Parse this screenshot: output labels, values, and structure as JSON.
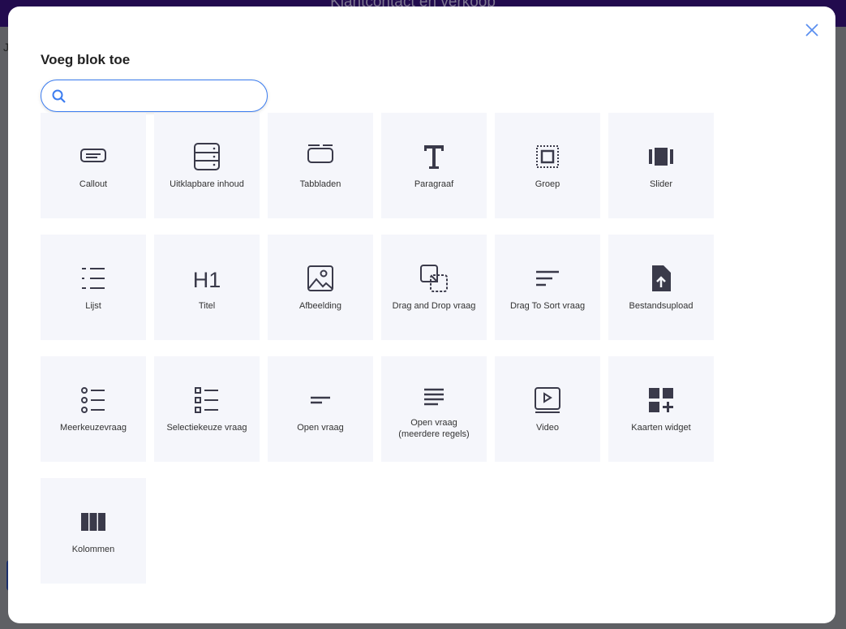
{
  "background": {
    "header_title": "Klantcontact en verkoop",
    "left_letter": "J"
  },
  "modal": {
    "title": "Voeg blok toe",
    "search": {
      "value": "",
      "placeholder": ""
    },
    "blocks": [
      {
        "label": "Callout",
        "icon": "callout-icon"
      },
      {
        "label": "Uitklapbare inhoud",
        "icon": "accordion-icon"
      },
      {
        "label": "Tabbladen",
        "icon": "tabs-icon"
      },
      {
        "label": "Paragraaf",
        "icon": "text-icon"
      },
      {
        "label": "Groep",
        "icon": "group-icon"
      },
      {
        "label": "Slider",
        "icon": "slider-icon"
      },
      {
        "label": "Lijst",
        "icon": "list-icon"
      },
      {
        "label": "Titel",
        "icon": "heading-icon"
      },
      {
        "label": "Afbeelding",
        "icon": "image-icon"
      },
      {
        "label": "Drag and Drop vraag",
        "icon": "drag-drop-icon"
      },
      {
        "label": "Drag To Sort vraag",
        "icon": "sort-icon"
      },
      {
        "label": "Bestandsupload",
        "icon": "file-upload-icon"
      },
      {
        "label": "Meerkeuzevraag",
        "icon": "radio-list-icon"
      },
      {
        "label": "Selectiekeuze vraag",
        "icon": "checkbox-list-icon"
      },
      {
        "label": "Open vraag",
        "icon": "short-text-icon"
      },
      {
        "label": "Open vraag\n(meerdere regels)",
        "icon": "long-text-icon"
      },
      {
        "label": "Video",
        "icon": "video-icon"
      },
      {
        "label": "Kaarten widget",
        "icon": "cards-widget-icon"
      },
      {
        "label": "Kolommen",
        "icon": "columns-icon"
      }
    ],
    "accent": "#3b7cf0"
  }
}
